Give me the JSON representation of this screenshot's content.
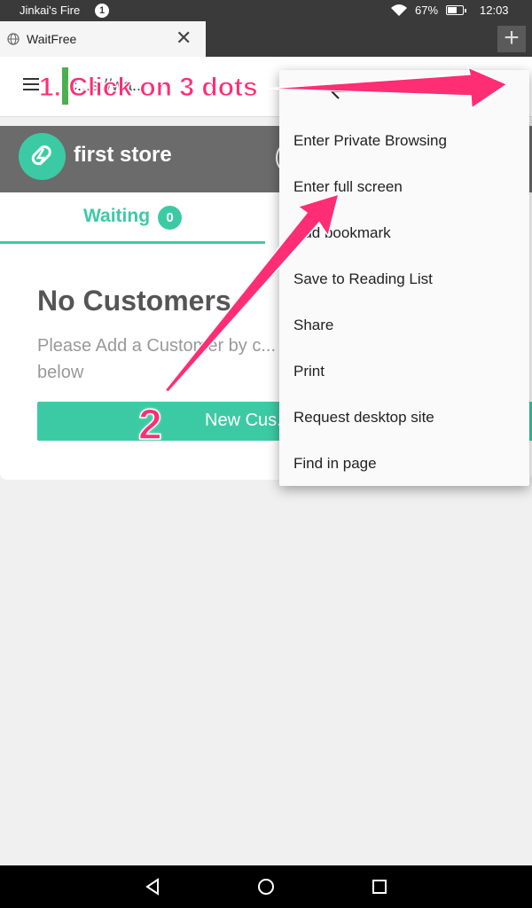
{
  "status_bar": {
    "carrier": "Jinkai's Fire",
    "notification_count": "1",
    "battery": "67%",
    "battery_level": 0.67,
    "time": "12:03"
  },
  "browser": {
    "tab_title": "WaitFree",
    "new_tab_label": "+",
    "url_text": "c...s://wa..."
  },
  "app": {
    "accent_color": "#3ccaa4",
    "store_name": "first store",
    "waiting_label": "Waiting",
    "waiting_count": "0",
    "empty_title": "No Customers",
    "empty_hint": "Please Add a Customer by c... below",
    "new_button_label": "New Cus..."
  },
  "menu": {
    "items": [
      "Enter Private Browsing",
      "Enter full screen",
      "Add bookmark",
      "Save to Reading List",
      "Share",
      "Print",
      "Request desktop site",
      "Find in page"
    ]
  },
  "annotations": {
    "step1": "1. Click on 3 dots",
    "step2": "2",
    "color": "#ff2d74"
  }
}
